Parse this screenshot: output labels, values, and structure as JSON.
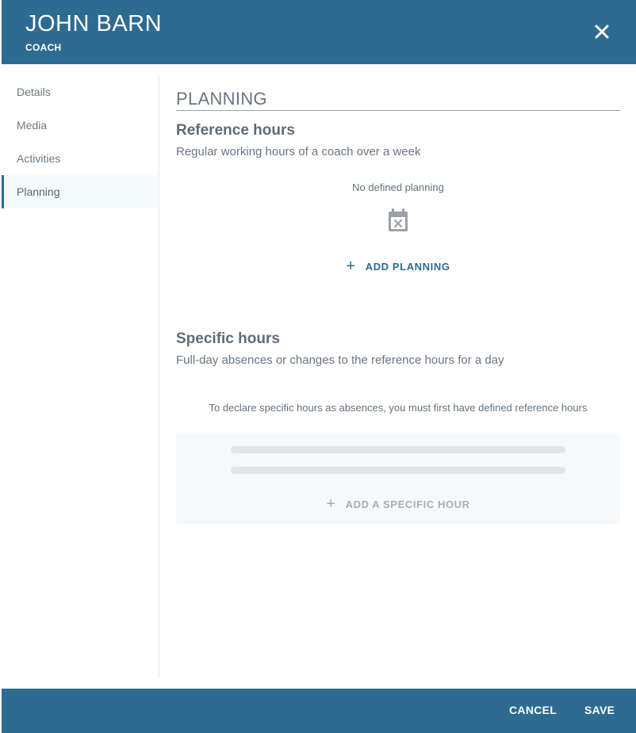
{
  "header": {
    "name": "JOHN BARN",
    "role": "COACH"
  },
  "sidebar": {
    "items": [
      {
        "label": "Details"
      },
      {
        "label": "Media"
      },
      {
        "label": "Activities"
      },
      {
        "label": "Planning",
        "active": true
      }
    ]
  },
  "planning": {
    "section_title": "PLANNING",
    "reference": {
      "title": "Reference hours",
      "description": "Regular working hours of a coach over a week",
      "empty_text": "No defined planning",
      "add_label": "ADD PLANNING"
    },
    "specific": {
      "title": "Specific hours",
      "description": "Full-day absences or changes to the reference hours for a day",
      "notice": "To declare specific hours as absences, you must first have defined reference hours",
      "add_label": "ADD A SPECIFIC HOUR"
    }
  },
  "footer": {
    "cancel_label": "CANCEL",
    "save_label": "SAVE"
  },
  "colors": {
    "brand": "#2e6b91",
    "active_bg": "#f5fafa",
    "disabled_text": "#a8b0b6"
  },
  "icons": {
    "close": "close-icon",
    "calendar": "calendar-remove-icon",
    "plus": "plus-icon"
  }
}
